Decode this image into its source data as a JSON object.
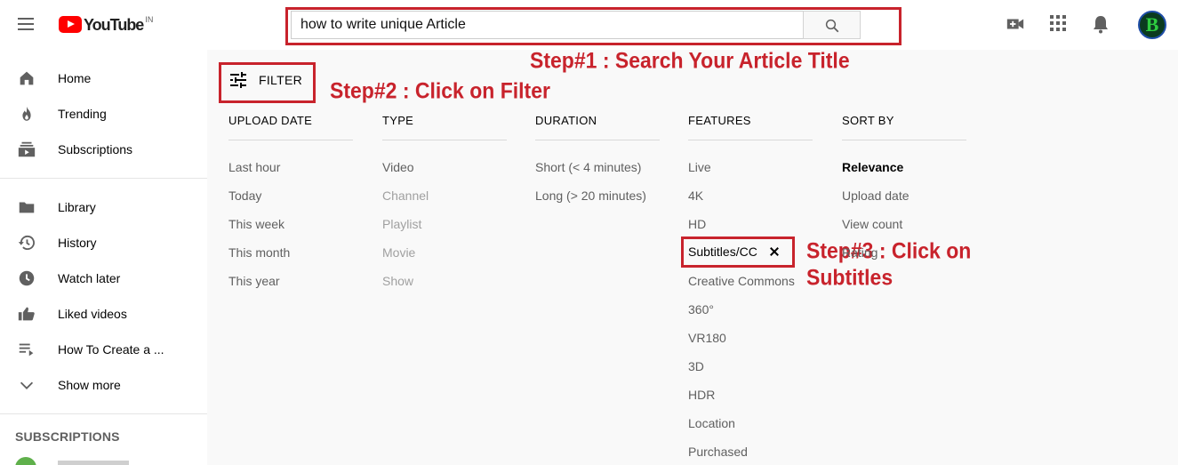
{
  "header": {
    "logo_text": "YouTube",
    "logo_country": "IN",
    "search_value": "how to write unique Article",
    "avatar_letter": "B"
  },
  "sidebar": {
    "items": [
      {
        "label": "Home",
        "icon": "home-icon"
      },
      {
        "label": "Trending",
        "icon": "flame-icon"
      },
      {
        "label": "Subscriptions",
        "icon": "subscriptions-icon"
      },
      {
        "label": "Library",
        "icon": "folder-icon"
      },
      {
        "label": "History",
        "icon": "history-icon"
      },
      {
        "label": "Watch later",
        "icon": "clock-icon"
      },
      {
        "label": "Liked videos",
        "icon": "thumbs-up-icon"
      },
      {
        "label": "How To Create a ...",
        "icon": "playlist-icon"
      },
      {
        "label": "Show more",
        "icon": "chevron-down-icon"
      }
    ],
    "subscriptions_heading": "SUBSCRIPTIONS"
  },
  "filter": {
    "button_label": "FILTER",
    "columns": [
      {
        "heading": "UPLOAD DATE",
        "items": [
          "Last hour",
          "Today",
          "This week",
          "This month",
          "This year"
        ]
      },
      {
        "heading": "TYPE",
        "items": [
          "Video",
          "Channel",
          "Playlist",
          "Movie",
          "Show"
        ]
      },
      {
        "heading": "DURATION",
        "items": [
          "Short (< 4 minutes)",
          "Long (> 20 minutes)"
        ]
      },
      {
        "heading": "FEATURES",
        "items": [
          "Live",
          "4K",
          "HD",
          "Subtitles/CC",
          "Creative Commons",
          "360°",
          "VR180",
          "3D",
          "HDR",
          "Location",
          "Purchased"
        ]
      },
      {
        "heading": "SORT BY",
        "items": [
          "Relevance",
          "Upload date",
          "View count",
          "Rating"
        ]
      }
    ]
  },
  "annotations": {
    "step1": "Step#1 : Search Your Article Title",
    "step2": "Step#2 : Click on Filter",
    "step3_line1": "Step#3 : Click on",
    "step3_line2": "Subtitles"
  },
  "colors": {
    "annotation_red": "#c8232c",
    "youtube_red": "#ff0000"
  }
}
